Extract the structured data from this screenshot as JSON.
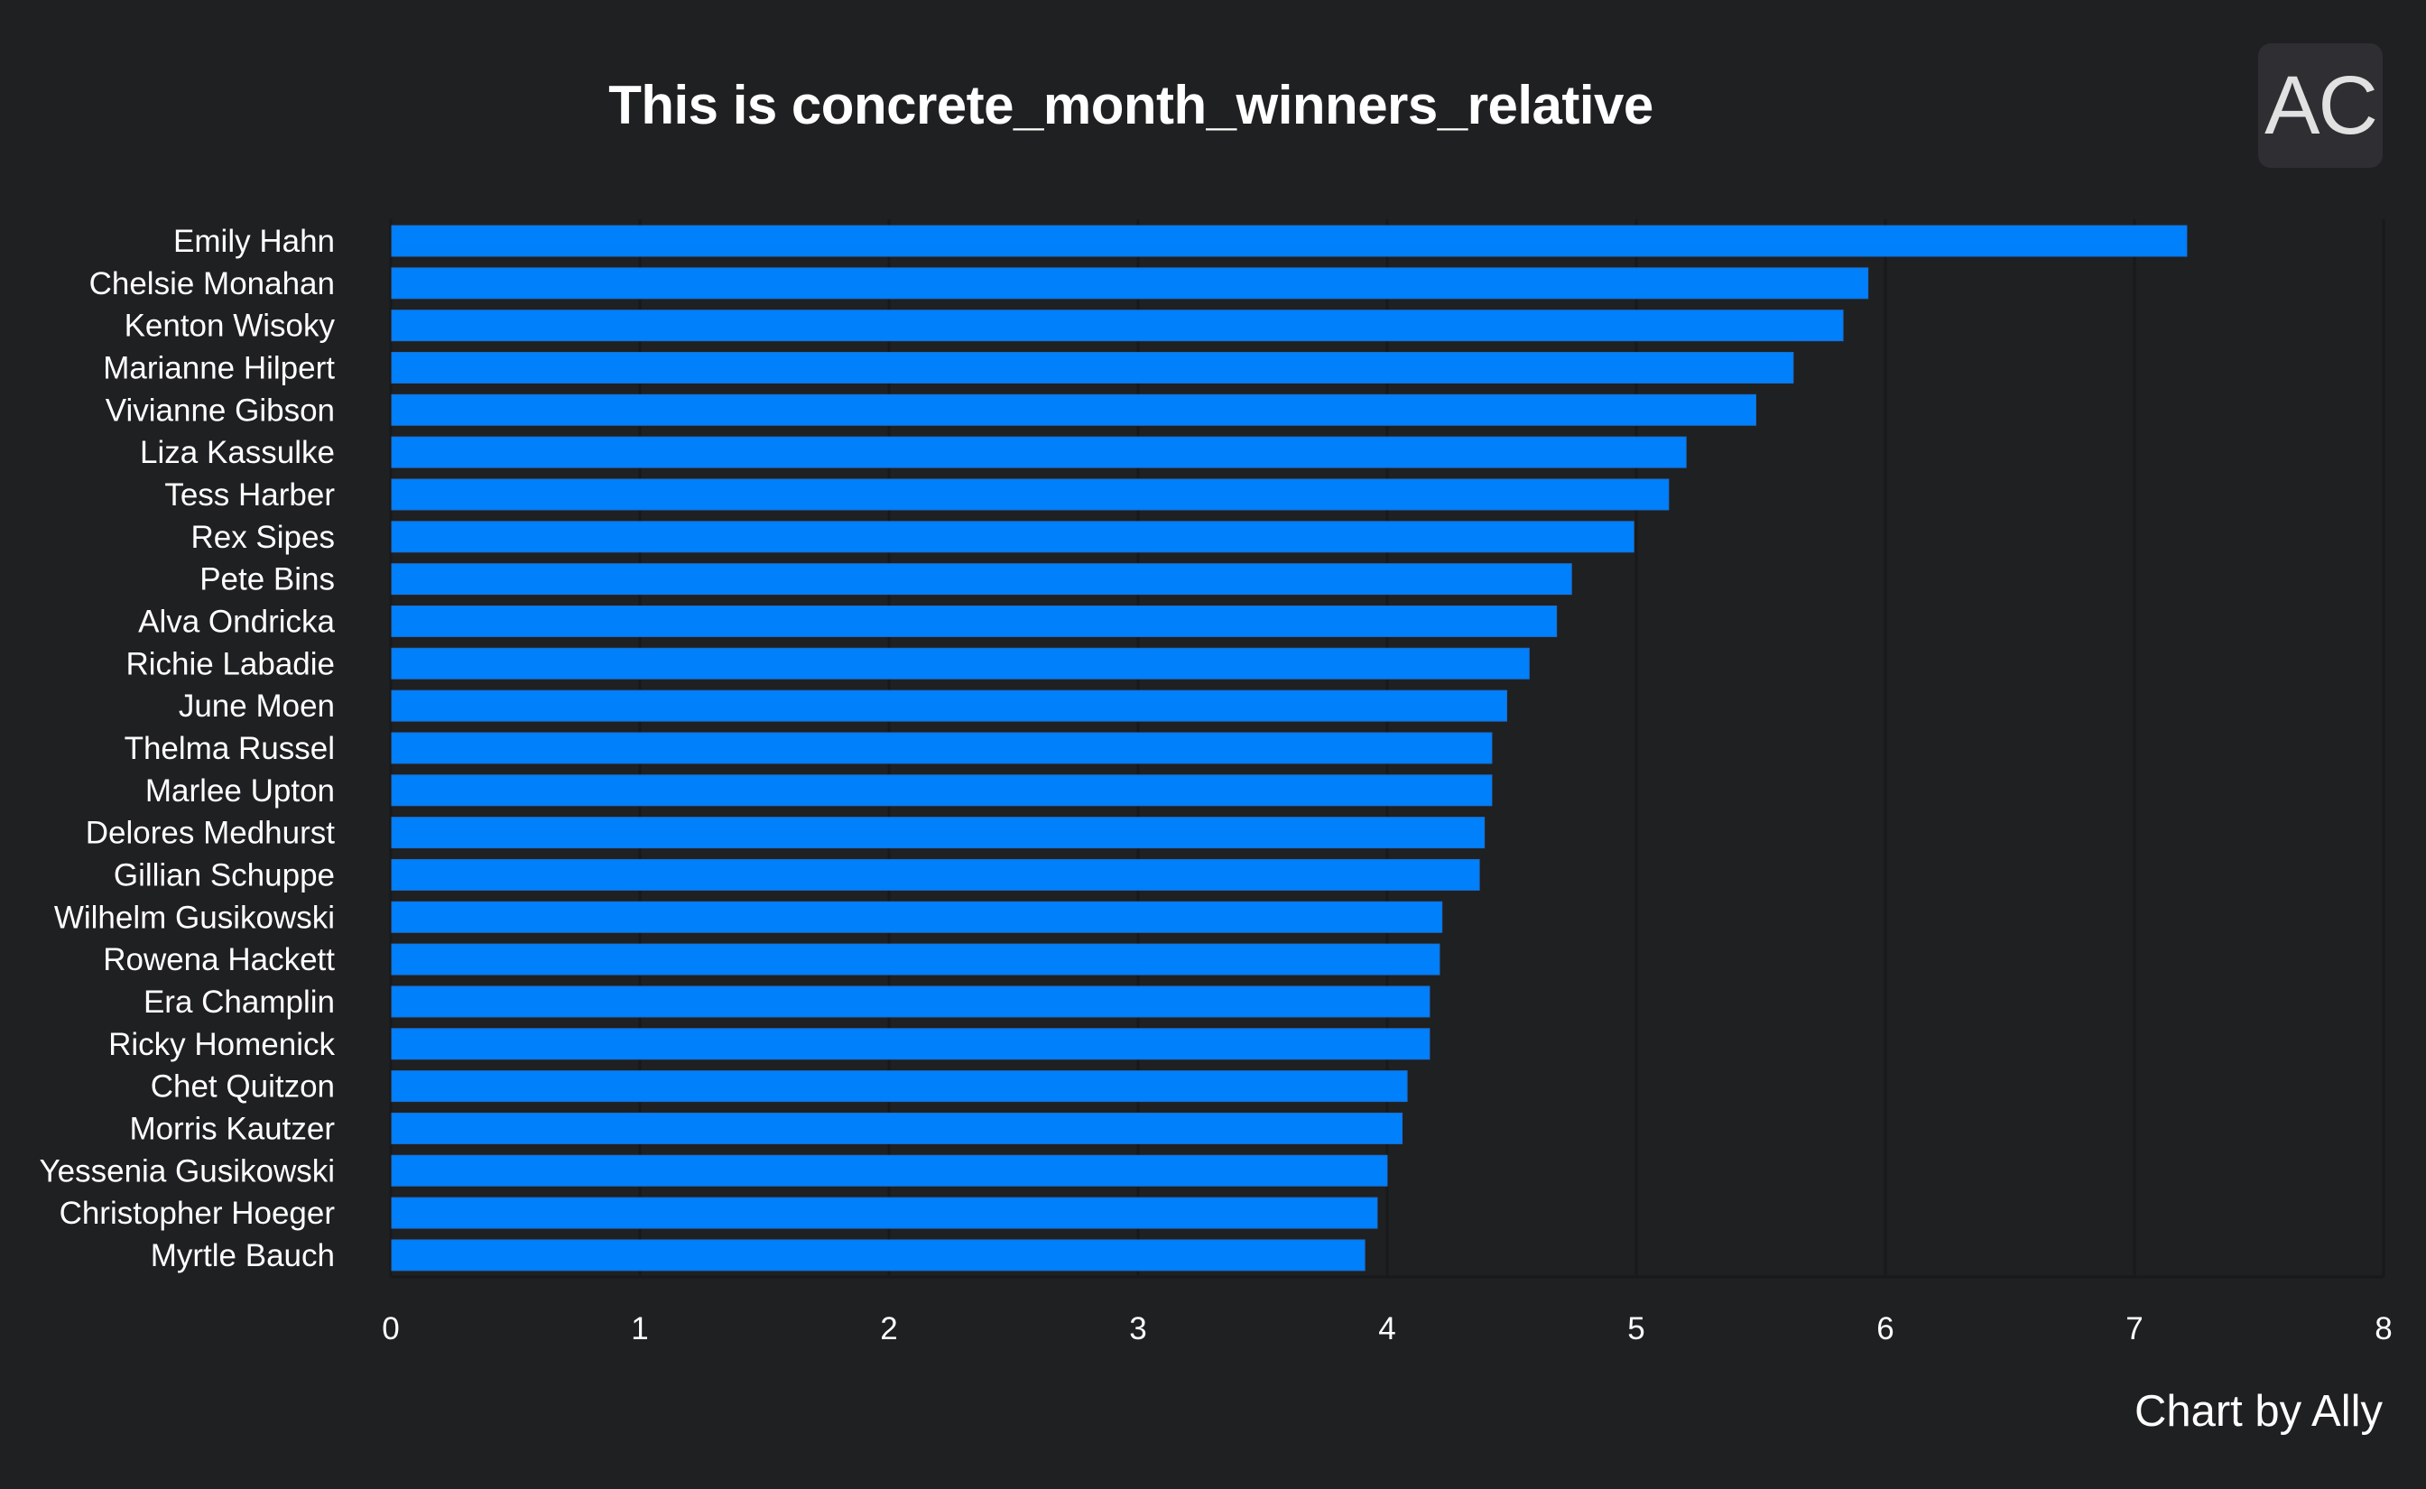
{
  "header": {
    "title": "This is concrete_month_winners_relative",
    "badge": "AC"
  },
  "footer": {
    "credit": "Chart by Ally"
  },
  "colors": {
    "background": "#1f2022",
    "bar": "#0080fb",
    "grid": "#18191b",
    "text": "#ffffff",
    "badge_bg": "#2e2e33",
    "badge_text": "#e1e1e1"
  },
  "chart_data": {
    "type": "bar",
    "orientation": "horizontal",
    "title": "This is concrete_month_winners_relative",
    "xlabel": "",
    "ylabel": "",
    "xlim": [
      0,
      8
    ],
    "xticks": [
      "0",
      "1",
      "2",
      "3",
      "4",
      "5",
      "6",
      "7",
      "8"
    ],
    "grid": "vertical",
    "legend": "none",
    "categories": [
      "Emily Hahn",
      "Chelsie Monahan",
      "Kenton Wisoky",
      "Marianne Hilpert",
      "Vivianne Gibson",
      "Liza Kassulke",
      "Tess Harber",
      "Rex Sipes",
      "Pete Bins",
      "Alva Ondricka",
      "Richie Labadie",
      "June Moen",
      "Thelma Russel",
      "Marlee Upton",
      "Delores Medhurst",
      "Gillian Schuppe",
      "Wilhelm Gusikowski",
      "Rowena Hackett",
      "Era Champlin",
      "Ricky Homenick",
      "Chet Quitzon",
      "Morris Kautzer",
      "Yessenia Gusikowski",
      "Christopher Hoeger",
      "Myrtle Bauch"
    ],
    "values": [
      7.21,
      5.93,
      5.83,
      5.63,
      5.48,
      5.2,
      5.13,
      4.99,
      4.74,
      4.68,
      4.57,
      4.48,
      4.42,
      4.42,
      4.39,
      4.37,
      4.22,
      4.21,
      4.17,
      4.17,
      4.08,
      4.06,
      4.0,
      3.96,
      3.91
    ]
  }
}
